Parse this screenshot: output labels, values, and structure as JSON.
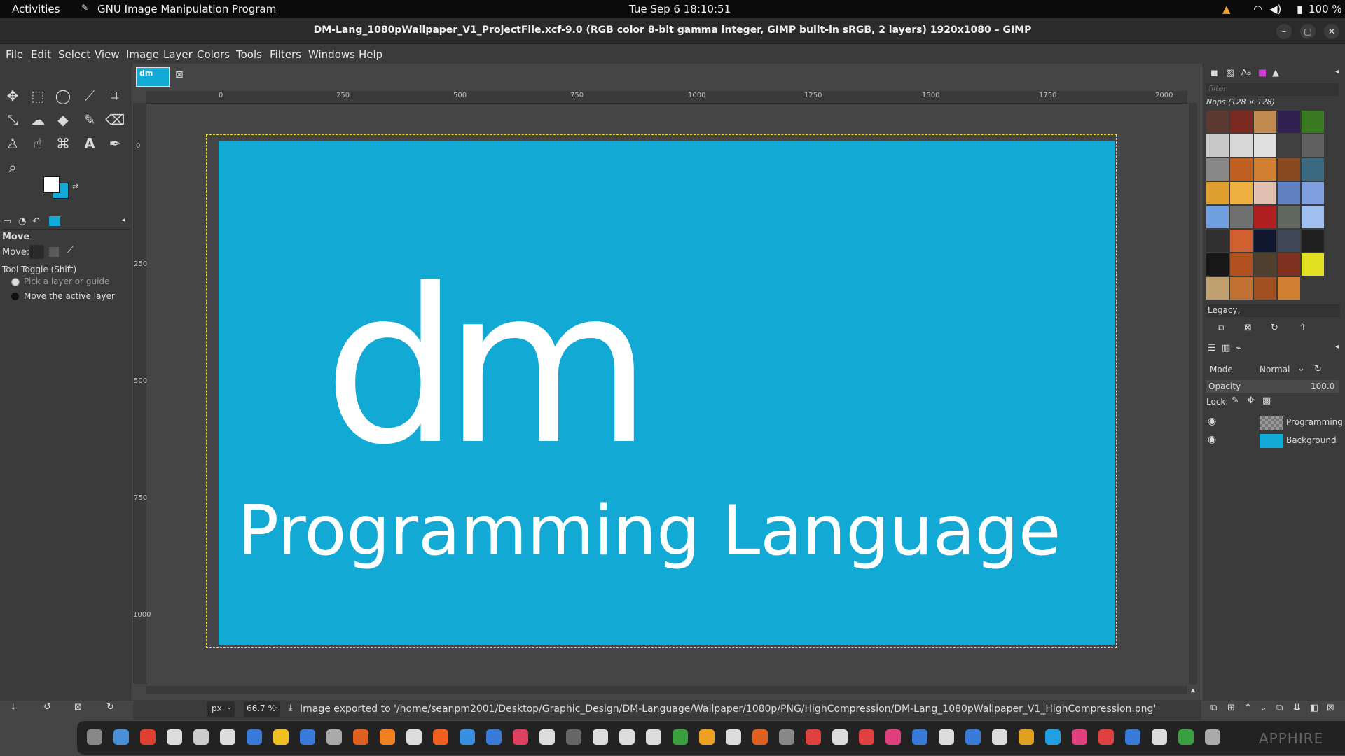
{
  "topbar": {
    "activities": "Activities",
    "app": "GNU Image Manipulation Program",
    "clock": "Tue Sep 6  18:10:51",
    "battery": "100 %"
  },
  "window": {
    "title": "DM-Lang_1080pWallpaper_V1_ProjectFile.xcf-9.0 (RGB color 8-bit gamma integer, GIMP built-in sRGB, 2 layers) 1920x1080 – GIMP"
  },
  "menu": [
    "File",
    "Edit",
    "Select",
    "View",
    "Image",
    "Layer",
    "Colors",
    "Tools",
    "Filters",
    "Windows",
    "Help"
  ],
  "tool_options": {
    "title": "Move",
    "move_label": "Move:",
    "toggle_label": "Tool Toggle  (Shift)",
    "option1": "Pick a layer or guide",
    "option2": "Move the active layer"
  },
  "tab": {
    "thumb_label": "dm"
  },
  "ruler": {
    "h": [
      "0",
      "250",
      "500",
      "750",
      "1000",
      "1250",
      "1500",
      "1750",
      "2000"
    ],
    "v": [
      "0",
      "250",
      "500",
      "750",
      "1000"
    ]
  },
  "image": {
    "logo": "dm",
    "caption": "Programming Language"
  },
  "status": {
    "unit": "px",
    "zoom": "66.7 %",
    "message": "Image exported to '/home/seanpm2001/Desktop/Graphic_Design/DM-Language/Wallpaper/1080p/PNG/HighCompression/DM-Lang_1080pWallpaper_V1_HighCompression.png'"
  },
  "patterns": {
    "filter_placeholder": "filter",
    "set_title": "Nops (128 × 128)",
    "tag": "Legacy,"
  },
  "layers_panel": {
    "mode_label": "Mode",
    "mode_value": "Normal",
    "opacity_label": "Opacity",
    "opacity_value": "100.0",
    "lock_label": "Lock:",
    "layers": [
      {
        "name": "Programming"
      },
      {
        "name": "Background"
      }
    ]
  },
  "colors": {
    "fg": "#ffffff",
    "bg": "#12a9d5",
    "canvas": "#12a9d5"
  },
  "taskbar": {
    "brand": "APPHIRE"
  }
}
